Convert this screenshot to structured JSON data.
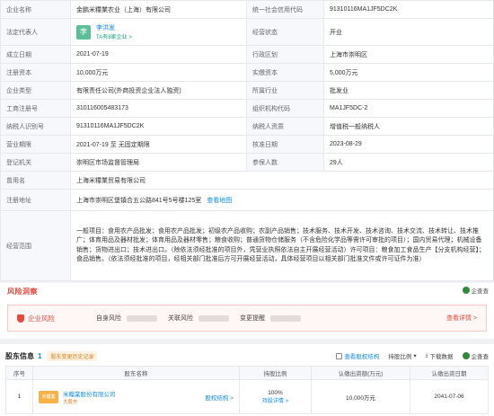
{
  "registration": {
    "rows": [
      {
        "l1": "企业名称",
        "v1": "金鹏米糧業农业（上海）有限公司",
        "l2": "统一社会信用代码",
        "v2": "91310116MA1JF5DC2K"
      },
      {
        "l1": "法定代表人",
        "l2": "经营状态",
        "v2": "开业"
      },
      {
        "l1": "成立日期",
        "v1": "2021-07-19",
        "l2": "行政区划",
        "v2": "上海市崇明区"
      },
      {
        "l1": "注册资本",
        "v1": "10,000万元",
        "l2": "实缴资本",
        "v2": "5,000万元"
      },
      {
        "l1": "企业类型",
        "v1": "有限责任公司(外商投资企业法人独资)",
        "l2": "所属行业",
        "v2": "批发业"
      },
      {
        "l1": "工商注册号",
        "v1": "310116005483173",
        "l2": "组织机构代码",
        "v2": "MA1JF5DC-2"
      },
      {
        "l1": "纳税人识别号",
        "v1": "91310116MA1JF5DC2K",
        "l2": "纳税人资质",
        "v2": "增值税一般纳税人"
      },
      {
        "l1": "营业期限",
        "v1": "2021-07-19 至 无固定期限",
        "l2": "核准日期",
        "v2": "2023-08-29"
      },
      {
        "l1": "登记机关",
        "v1": "崇明区市场监督管理局",
        "l2": "参保人数",
        "v2": "29人"
      }
    ],
    "legal_rep": {
      "avatar": "李",
      "name": "李洪发",
      "sub": "TA有8家企业 >"
    },
    "former_name_label": "曾用名",
    "former_name": "上海米糧業贸易有限公司",
    "address_label": "注册地址",
    "address": "上海市崇明区堡镇合五公路841号5号楼125室",
    "address_link": "查看地图",
    "scope_label": "经营范围",
    "scope": "一般项目：食用农产品批发；食用农产品批发；初级农产品收购；农副产品销售；技术服务、技术开发、技术咨询、技术交流、技术转让、技术推广；体育用品及器材批发；体育用品及器材零售；粮食收购；普通货物仓储服务（不含危险化学品等需许可审批的项目）；国内贸易代理；机械设备销售；货物进出口；技术进出口。（除依法须经批准的项目外，凭营业执照依法自主开展经营活动）许可项目：粮食加工食品生产【分支机构经营】；食品销售。（依法须经批准的项目，经相关部门批准后方可开展经营活动，具体经营项目以相关部门批准文件或许可证件为准）"
  },
  "risk": {
    "title": "风险洞察",
    "brand": "企查查",
    "main": "企业风险",
    "items": [
      "自身风险",
      "关联风险",
      "变更提醒"
    ],
    "more": "查看详情 >"
  },
  "shareholders": {
    "title": "股东信息",
    "count": "1",
    "tag": "股东变更历史记录",
    "actions": [
      "查看股权结构",
      "持股比例",
      "下载数据"
    ],
    "brand": "企查查",
    "headers": [
      "序号",
      "股东名称",
      "持股比例",
      "认缴出资额(万元)",
      "认缴出资日期"
    ],
    "rows": [
      {
        "idx": "1",
        "logo": "米糧業",
        "name": "米糧業股份有限公司",
        "sub": "大股东",
        "relation": "股权结构 >",
        "pct": "100%",
        "pct_sub": "持股详情 >",
        "amount": "10,000万元",
        "date": "2041-07-06"
      }
    ]
  }
}
